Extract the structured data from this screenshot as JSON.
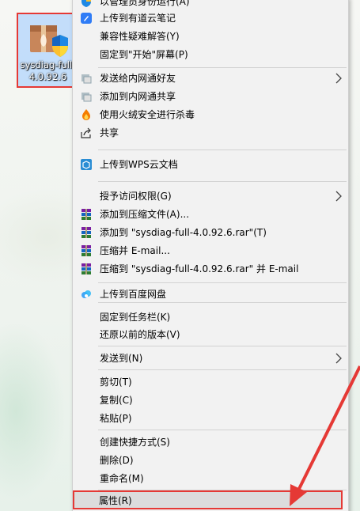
{
  "desktop_icon": {
    "label": "sysdiag-full-\n4.0.92.6"
  },
  "menu": {
    "items": [
      {
        "label": "以管理员身份运行(A)",
        "icon": "shield-icon"
      },
      {
        "label": "上传到有道云笔记",
        "icon": "youdao-note-icon"
      },
      {
        "label": "兼容性疑难解答(Y)",
        "icon": ""
      },
      {
        "label": "固定到\"开始\"屏幕(P)",
        "icon": ""
      },
      {
        "label": "发送给内网通好友",
        "icon": "intranet-send-icon",
        "submenu": true
      },
      {
        "label": "添加到内网通共享",
        "icon": "intranet-share-icon"
      },
      {
        "label": "使用火绒安全进行杀毒",
        "icon": "huorong-flame-icon"
      },
      {
        "label": "共享",
        "icon": "share-icon"
      },
      {
        "label": "上传到WPS云文档",
        "icon": "wps-cloud-icon"
      },
      {
        "label": "授予访问权限(G)",
        "icon": "",
        "submenu": true
      },
      {
        "label": "添加到压缩文件(A)...",
        "icon": "winrar-icon"
      },
      {
        "label": "添加到 \"sysdiag-full-4.0.92.6.rar\"(T)",
        "icon": "winrar-icon"
      },
      {
        "label": "压缩并 E-mail...",
        "icon": "winrar-icon"
      },
      {
        "label": "压缩到 \"sysdiag-full-4.0.92.6.rar\" 并 E-mail",
        "icon": "winrar-icon"
      },
      {
        "label": "上传到百度网盘",
        "icon": "baidu-netdisk-icon"
      },
      {
        "label": "固定到任务栏(K)",
        "icon": ""
      },
      {
        "label": "还原以前的版本(V)",
        "icon": ""
      },
      {
        "label": "发送到(N)",
        "icon": "",
        "submenu": true
      },
      {
        "label": "剪切(T)",
        "icon": ""
      },
      {
        "label": "复制(C)",
        "icon": ""
      },
      {
        "label": "粘贴(P)",
        "icon": ""
      },
      {
        "label": "创建快捷方式(S)",
        "icon": ""
      },
      {
        "label": "删除(D)",
        "icon": ""
      },
      {
        "label": "重命名(M)",
        "icon": ""
      },
      {
        "label": "属性(R)",
        "icon": ""
      }
    ]
  },
  "colors": {
    "highlight_border": "#e53935",
    "menu_bg": "#f2f2f2"
  }
}
